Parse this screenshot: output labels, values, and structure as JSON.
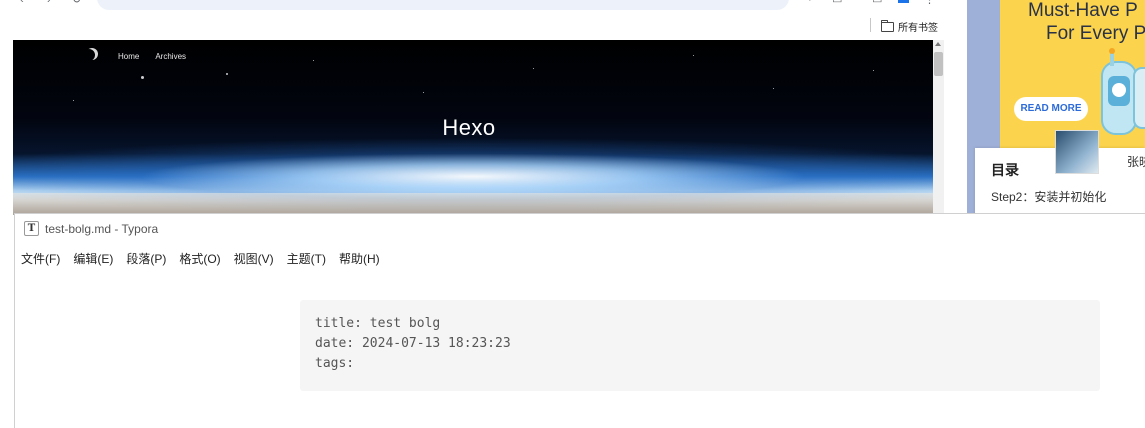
{
  "browser": {
    "address_text": "",
    "bookmarks_folder": "所有书签",
    "site": {
      "nav": [
        "Home",
        "Archives"
      ],
      "title": "Hexo"
    }
  },
  "sidebar": {
    "ad": {
      "headline_line1": "Must-Have P",
      "headline_line2": "For Every P",
      "button": "READ MORE"
    },
    "toc": {
      "title": "目录",
      "author": "张晓",
      "item": "Step2：安装并初始化"
    }
  },
  "typora": {
    "window_title": "test-bolg.md - Typora",
    "menu": [
      "文件(F)",
      "编辑(E)",
      "段落(P)",
      "格式(O)",
      "视图(V)",
      "主题(T)",
      "帮助(H)"
    ],
    "front_matter": [
      "title: test bolg",
      "date: 2024-07-13 18:23:23",
      "tags:"
    ]
  },
  "colors": {
    "ad_background": "#fbd34d",
    "ad_button_text": "#2d6bd8",
    "side_strip": "#9fb0d8",
    "front_matter_bg": "#f5f5f5"
  }
}
